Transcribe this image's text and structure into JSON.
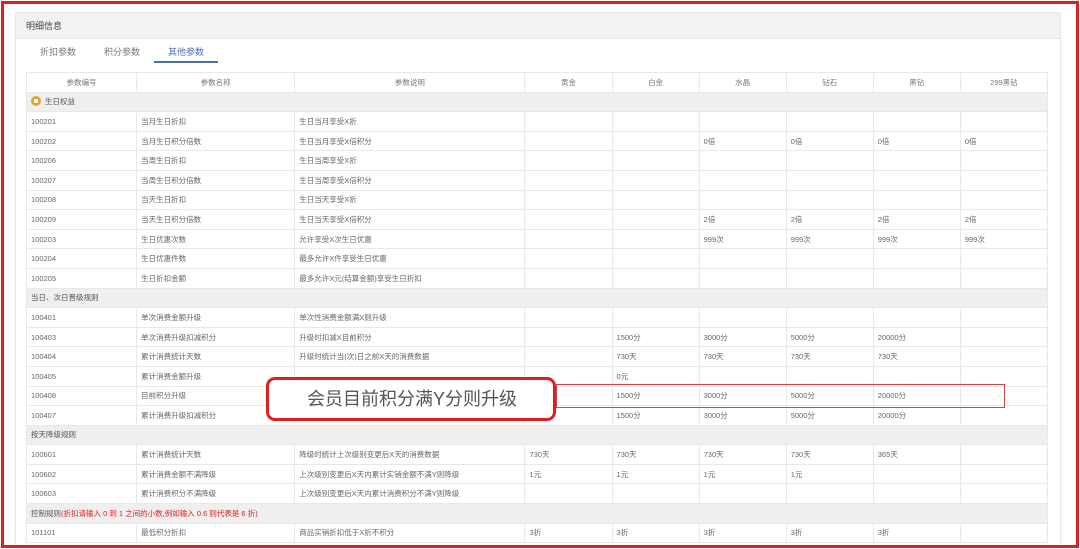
{
  "panel_title": "明细信息",
  "tabs": [
    {
      "label": "折扣参数",
      "active": false
    },
    {
      "label": "积分参数",
      "active": false
    },
    {
      "label": "其他参数",
      "active": true
    }
  ],
  "columns": [
    "参数编号",
    "参数名称",
    "参数说明",
    "黄金",
    "白金",
    "水晶",
    "钻石",
    "黑钻",
    "299黑钻"
  ],
  "rows": [
    {
      "type": "group",
      "icon": true,
      "label": "生日权益"
    },
    {
      "cells": [
        "100201",
        "当月生日折扣",
        "生日当月享受X折",
        "",
        "",
        "",
        "",
        "",
        ""
      ]
    },
    {
      "cells": [
        "100202",
        "当月生日积分倍数",
        "生日当月享受X倍积分",
        "",
        "",
        "0倍",
        "0倍",
        "0倍",
        "0倍"
      ]
    },
    {
      "cells": [
        "100206",
        "当周生日折扣",
        "生日当周享受X折",
        "",
        "",
        "",
        "",
        "",
        ""
      ]
    },
    {
      "cells": [
        "100207",
        "当周生日积分倍数",
        "生日当周享受X倍积分",
        "",
        "",
        "",
        "",
        "",
        ""
      ]
    },
    {
      "cells": [
        "100208",
        "当天生日折扣",
        "生日当天享受X折",
        "",
        "",
        "",
        "",
        "",
        ""
      ]
    },
    {
      "cells": [
        "100209",
        "当天生日积分倍数",
        "生日当天享受X倍积分",
        "",
        "",
        "2倍",
        "2倍",
        "2倍",
        "2倍"
      ]
    },
    {
      "cells": [
        "100203",
        "生日优惠次数",
        "允许享受X次生日优惠",
        "",
        "",
        "999次",
        "999次",
        "999次",
        "999次"
      ]
    },
    {
      "cells": [
        "100204",
        "生日优惠件数",
        "最多允许X件享受生日优惠",
        "",
        "",
        "",
        "",
        "",
        ""
      ]
    },
    {
      "cells": [
        "100205",
        "生日折扣金额",
        "最多允许X元(结算金额)享受生日折扣",
        "",
        "",
        "",
        "",
        "",
        ""
      ]
    },
    {
      "type": "group",
      "icon": false,
      "label": "当日、次日晋级规则"
    },
    {
      "cells": [
        "100401",
        "单次消费金额升级",
        "单次性消费金额满X则升级",
        "",
        "",
        "",
        "",
        "",
        ""
      ]
    },
    {
      "cells": [
        "100403",
        "单次消费升级扣减积分",
        "升级时扣减X目前积分",
        "",
        "1500分",
        "3000分",
        "5000分",
        "20000分",
        ""
      ]
    },
    {
      "cells": [
        "100404",
        "累计消费统计天数",
        "升级时统计当(次)日之前X天的消费数据",
        "",
        "730天",
        "730天",
        "730天",
        "730天",
        ""
      ]
    },
    {
      "cells": [
        "100405",
        "累计消费金额升级",
        "",
        "",
        "0元",
        "",
        "",
        "",
        ""
      ]
    },
    {
      "cells": [
        "100408",
        "目前积分升级",
        "",
        "",
        "1500分",
        "3000分",
        "5000分",
        "20000分",
        ""
      ]
    },
    {
      "cells": [
        "100407",
        "累计消费升级扣减积分",
        "",
        "",
        "1500分",
        "3000分",
        "5000分",
        "20000分",
        ""
      ]
    },
    {
      "type": "group",
      "icon": false,
      "label": "按天降级规则"
    },
    {
      "cells": [
        "100601",
        "累计消费统计天数",
        "降级时统计上次级别变更后X天的消费数据",
        "730天",
        "730天",
        "730天",
        "730天",
        "365天",
        ""
      ]
    },
    {
      "cells": [
        "100602",
        "累计消费金额不满降级",
        "上次级别变更后X天内累计实销金额不满Y则降级",
        "1元",
        "1元",
        "1元",
        "1元",
        "",
        ""
      ]
    },
    {
      "cells": [
        "100603",
        "累计消费积分不满降级",
        "上次级别变更后X天内累计消费积分不满Y则降级",
        "",
        "",
        "",
        "",
        "",
        ""
      ]
    },
    {
      "type": "group",
      "icon": false,
      "label": "控制规则",
      "note": "(折扣请输入 0 到 1 之间的小数,例如输入 0.6 则代表是 6 折)"
    },
    {
      "cells": [
        "101101",
        "最低积分折扣",
        "商品实销折扣低于X折不积分",
        "3折",
        "3折",
        "3折",
        "3折",
        "3折",
        ""
      ]
    }
  ],
  "callout": {
    "text": "会员目前积分满Y分则升级"
  },
  "colors": {
    "accent": "#4a6fb5",
    "highlight_red": "#e02020",
    "group_bg": "#efefef"
  }
}
